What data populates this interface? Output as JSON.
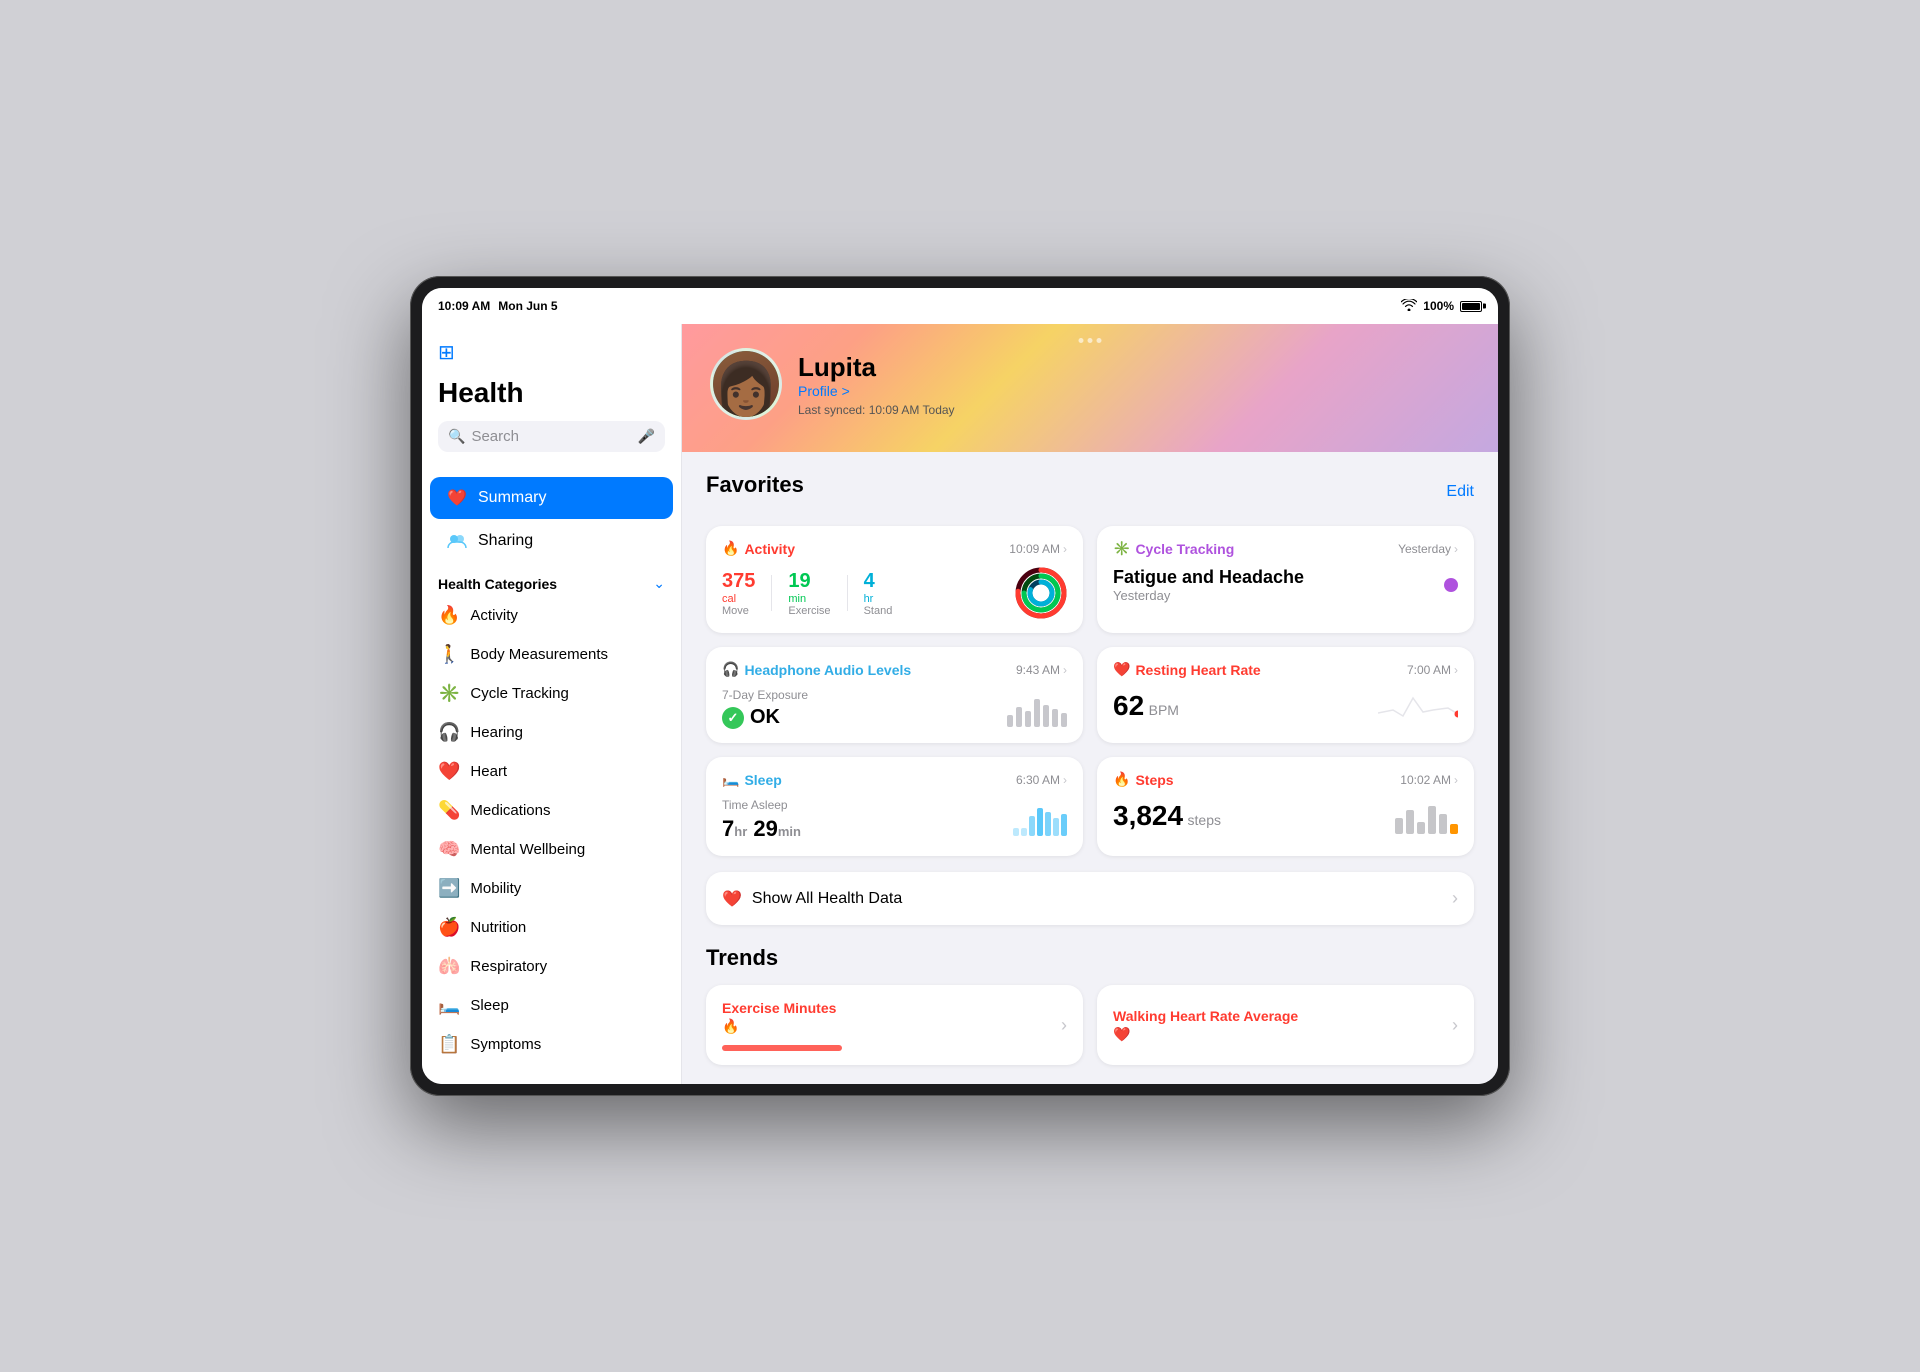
{
  "statusBar": {
    "time": "10:09 AM",
    "date": "Mon Jun 5",
    "wifi": "WiFi",
    "battery": "100%"
  },
  "sidebar": {
    "appTitle": "Health",
    "search": {
      "placeholder": "Search"
    },
    "sidebarToggleIcon": "sidebar-icon",
    "navItems": [
      {
        "id": "summary",
        "label": "Summary",
        "icon": "❤️",
        "active": true
      },
      {
        "id": "sharing",
        "label": "Sharing",
        "icon": "👥",
        "active": false
      }
    ],
    "categoriesTitle": "Health Categories",
    "categories": [
      {
        "id": "activity",
        "label": "Activity",
        "icon": "🔥",
        "color": "#ff3b30"
      },
      {
        "id": "body-measurements",
        "label": "Body Measurements",
        "icon": "🚶",
        "color": "#af52de"
      },
      {
        "id": "cycle-tracking",
        "label": "Cycle Tracking",
        "icon": "✳️",
        "color": "#af52de"
      },
      {
        "id": "hearing",
        "label": "Hearing",
        "icon": "🎧",
        "color": "#32ade6"
      },
      {
        "id": "heart",
        "label": "Heart",
        "icon": "❤️",
        "color": "#ff3b30"
      },
      {
        "id": "medications",
        "label": "Medications",
        "icon": "💊",
        "color": "#34c759"
      },
      {
        "id": "mental-wellbeing",
        "label": "Mental Wellbeing",
        "icon": "🧠",
        "color": "#32ade6"
      },
      {
        "id": "mobility",
        "label": "Mobility",
        "icon": "➡️",
        "color": "#ff9500"
      },
      {
        "id": "nutrition",
        "label": "Nutrition",
        "icon": "🍎",
        "color": "#34c759"
      },
      {
        "id": "respiratory",
        "label": "Respiratory",
        "icon": "🫁",
        "color": "#32ade6"
      },
      {
        "id": "sleep",
        "label": "Sleep",
        "icon": "🛏️",
        "color": "#32ade6"
      },
      {
        "id": "symptoms",
        "label": "Symptoms",
        "icon": "📋",
        "color": "#8e8e93"
      }
    ]
  },
  "profile": {
    "name": "Lupita",
    "profileLink": "Profile >",
    "syncText": "Last synced: 10:09 AM Today"
  },
  "favorites": {
    "sectionTitle": "Favorites",
    "editLabel": "Edit",
    "cards": {
      "activity": {
        "title": "Activity",
        "time": "10:09 AM",
        "move": {
          "value": "375",
          "unit": "cal",
          "label": "Move"
        },
        "exercise": {
          "value": "19",
          "unit": "min",
          "label": "Exercise"
        },
        "stand": {
          "value": "4",
          "unit": "hr",
          "label": "Stand"
        }
      },
      "cycleTracking": {
        "title": "Cycle Tracking",
        "time": "Yesterday",
        "symptom": "Fatigue and Headache",
        "symptomTime": "Yesterday"
      },
      "headphoneAudio": {
        "title": "Headphone Audio Levels",
        "time": "9:43 AM",
        "exposureLabel": "7-Day Exposure",
        "status": "OK"
      },
      "restingHeartRate": {
        "title": "Resting Heart Rate",
        "time": "7:00 AM",
        "value": "62",
        "unit": "BPM"
      },
      "sleep": {
        "title": "Sleep",
        "time": "6:30 AM",
        "timeAsleepLabel": "Time Asleep",
        "hours": "7",
        "minutes": "29",
        "hrUnit": "hr",
        "minUnit": "min"
      },
      "steps": {
        "title": "Steps",
        "time": "10:02 AM",
        "value": "3,824",
        "unit": "steps"
      }
    },
    "showAllLabel": "Show All Health Data"
  },
  "trends": {
    "sectionTitle": "Trends",
    "items": [
      {
        "id": "exercise-minutes",
        "label": "Exercise Minutes",
        "color": "#ff3b30"
      },
      {
        "id": "walking-heart-rate",
        "label": "Walking Heart Rate Average",
        "color": "#ff3b30"
      }
    ]
  }
}
